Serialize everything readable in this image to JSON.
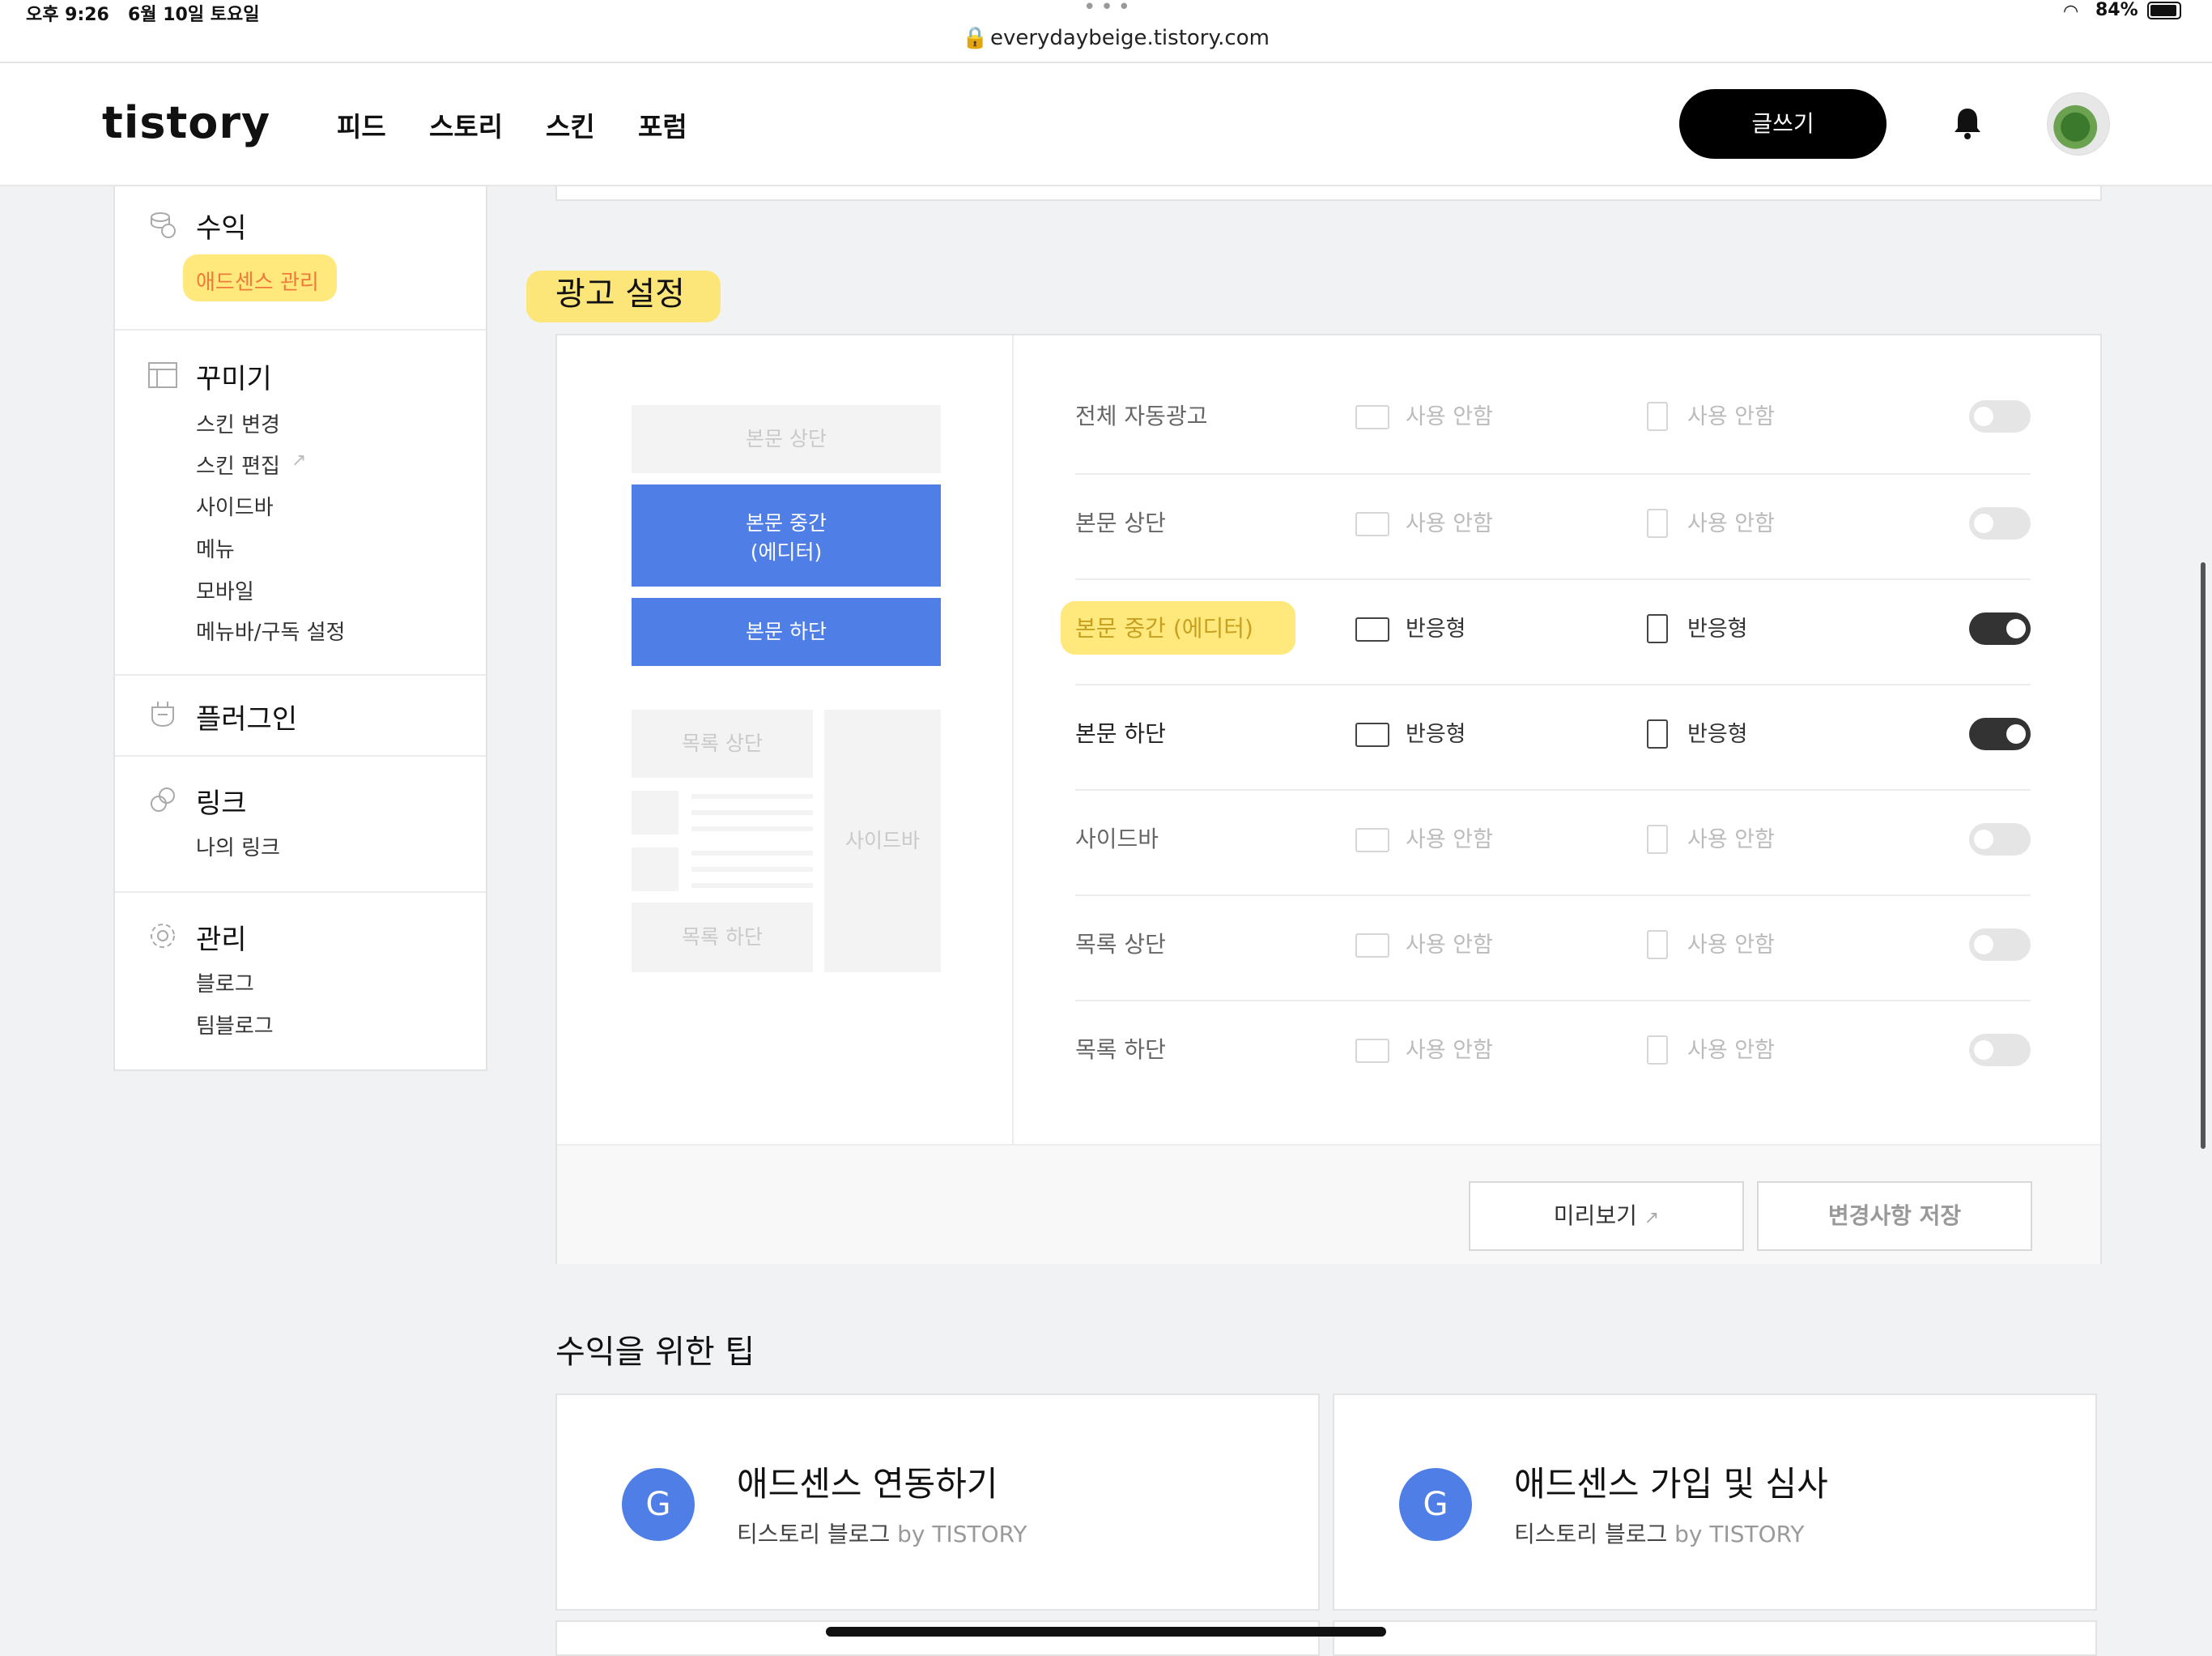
{
  "status": {
    "time": "오후 9:26",
    "date": "6월 10일 토요일",
    "url": "everydaybeige.tistory.com",
    "battery": "84%"
  },
  "header": {
    "logo": "tistory",
    "nav": [
      "피드",
      "스토리",
      "스킨",
      "포럼"
    ],
    "write_label": "글쓰기"
  },
  "sidebar": {
    "revenue": {
      "title": "수익",
      "items": [
        "애드센스 관리"
      ]
    },
    "decorate": {
      "title": "꾸미기",
      "items": [
        "스킨 변경",
        "스킨 편집",
        "사이드바",
        "메뉴",
        "모바일",
        "메뉴바/구독 설정"
      ]
    },
    "plugin": {
      "title": "플러그인"
    },
    "link": {
      "title": "링크",
      "items": [
        "나의 링크"
      ]
    },
    "manage": {
      "title": "관리",
      "items": [
        "블로그",
        "팀블로그"
      ]
    }
  },
  "ad_settings": {
    "title": "광고 설정",
    "preview": {
      "body_top": "본문 상단",
      "body_mid_line1": "본문 중간",
      "body_mid_line2": "(에디터)",
      "body_bottom": "본문 하단",
      "list_top": "목록 상단",
      "list_bottom": "목록 하단",
      "sidebar": "사이드바"
    },
    "rows": [
      {
        "label": "전체 자동광고",
        "pc": "사용 안함",
        "mobile": "사용 안함",
        "enabled": false
      },
      {
        "label": "본문 상단",
        "pc": "사용 안함",
        "mobile": "사용 안함",
        "enabled": false
      },
      {
        "label": "본문 중간 (에디터)",
        "pc": "반응형",
        "mobile": "반응형",
        "enabled": true
      },
      {
        "label": "본문 하단",
        "pc": "반응형",
        "mobile": "반응형",
        "enabled": true
      },
      {
        "label": "사이드바",
        "pc": "사용 안함",
        "mobile": "사용 안함",
        "enabled": false
      },
      {
        "label": "목록 상단",
        "pc": "사용 안함",
        "mobile": "사용 안함",
        "enabled": false
      },
      {
        "label": "목록 하단",
        "pc": "사용 안함",
        "mobile": "사용 안함",
        "enabled": false
      }
    ],
    "preview_button": "미리보기",
    "save_button": "변경사항 저장"
  },
  "tips": {
    "title": "수익을 위한 팁",
    "cards": [
      {
        "icon_letter": "G",
        "title": "애드센스 연동하기",
        "source": "티스토리 블로그",
        "by": "by TISTORY"
      },
      {
        "icon_letter": "G",
        "title": "애드센스 가입 및 심사",
        "source": "티스토리 블로그",
        "by": "by TISTORY"
      }
    ]
  },
  "colors": {
    "accent_blue": "#4f7fe6",
    "highlight_yellow": "#ffe250",
    "sidebar_active": "#f07a3a"
  }
}
